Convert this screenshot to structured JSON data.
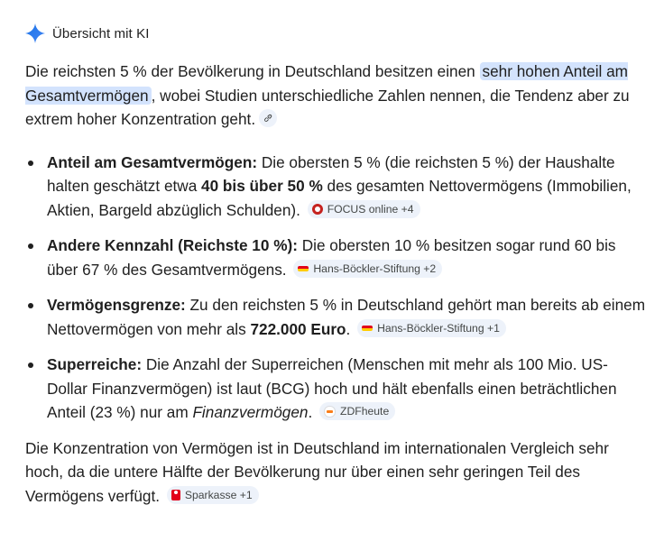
{
  "header": {
    "title": "Übersicht mit KI",
    "icon": "gemini-spark-icon",
    "accent_color": "#4285f4"
  },
  "intro": {
    "text_before": "Die reichsten 5 % der Bevölkerung in Deutschland besitzen einen ",
    "highlight": "sehr hohen Anteil am Gesamtvermögen",
    "text_after": ", wobei Studien unterschiedliche Zahlen nennen, die Tendenz aber zu extrem hoher Konzentration geht.",
    "link_icon": "link-icon"
  },
  "bullets": [
    {
      "label": "Anteil am Gesamtvermögen:",
      "text_1": " Die obersten 5 % (die reichsten 5 %) der Haushalte halten geschätzt etwa ",
      "bold": "40 bis über 50 %",
      "text_2": " des gesamten Nettovermögens (Immobilien, Aktien, Bargeld abzüglich Schulden).",
      "source": "FOCUS online +4"
    },
    {
      "label": "Andere Kennzahl (Reichste 10 %):",
      "text_1": " Die obersten 10 % besitzen sogar rund 60 bis über 67 % des Gesamtvermögens.",
      "source": "Hans-Böckler-Stiftung +2"
    },
    {
      "label": "Vermögensgrenze:",
      "text_1": " Zu den reichsten 5 % in Deutschland gehört man bereits ab einem Nettovermögen von mehr als ",
      "bold": "722.000 Euro",
      "text_2": ".",
      "source": "Hans-Böckler-Stiftung +1"
    },
    {
      "label": "Superreiche:",
      "text_1": " Die Anzahl der Superreichen (Menschen mit mehr als 100 Mio. US-Dollar Finanzvermögen) ist laut (BCG) hoch und hält ebenfalls einen beträchtlichen Anteil (23 %) nur am ",
      "italic": "Finanzvermögen",
      "text_2": ".",
      "source": "ZDFheute"
    }
  ],
  "closing": {
    "text": "Die Konzentration von Vermögen ist in Deutschland im internationalen Vergleich sehr hoch, da die untere Hälfte der Bevölkerung nur über einen sehr geringen Teil des Vermögens verfügt.",
    "source": "Sparkasse +1"
  },
  "colors": {
    "highlight_bg": "#d3e3fd",
    "chip_bg": "#edf2fa",
    "text": "#1f1f1f"
  }
}
